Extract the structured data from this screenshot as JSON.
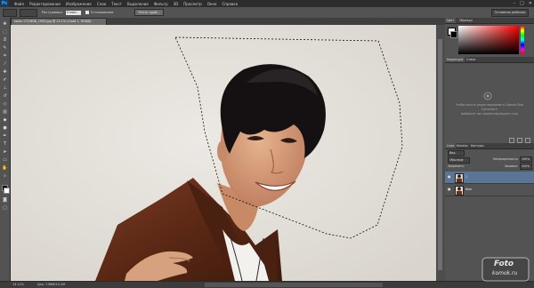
{
  "menubar": {
    "logo": "Ps",
    "items": [
      "Файл",
      "Редактирование",
      "Изображение",
      "Слои",
      "Текст",
      "Выделение",
      "Фильтр",
      "3D",
      "Просмотр",
      "Окно",
      "Справка"
    ]
  },
  "window_controls": [
    "–",
    "□",
    "✕"
  ],
  "options": {
    "feather_label": "Растушевка:",
    "feather_value": "0 пикс.",
    "antialias_label": "Сглаживание",
    "refine_button": "Уточн. край...",
    "workspace": "Основная рабочая среда"
  },
  "document": {
    "tab_title": "маке-1729838_1920.jpg @ 13.1% (Слой 1, RGB/8)"
  },
  "status": {
    "zoom": "13.11%",
    "doc_size": "Док: 7.88M/15.2M"
  },
  "panels": {
    "color_tabs": [
      "Цвет",
      "Образцы"
    ],
    "adjust_tabs": [
      "Коррекция",
      "Стили"
    ],
    "adjust_hint_1": "Чтобы начать редактирование в Camera Raw",
    "adjust_hint_2": "Щелкните",
    "adjust_hint_3": "выберите тип корректирующего слоя",
    "layer_tabs": [
      "Слои",
      "Каналы",
      "Контуры"
    ],
    "kind_filter": "Вид",
    "blend_mode": "Обычные",
    "opacity_label": "Непрозрачность:",
    "opacity_value": "100%",
    "lock_label": "Закрепить:",
    "fill_label": "Заливка:",
    "fill_value": "100%",
    "layers": [
      {
        "name": "1",
        "selected": true
      },
      {
        "name": "Фон",
        "selected": false
      }
    ]
  },
  "watermark": {
    "line1": "Foto",
    "line2": "komok.ru"
  },
  "colors": {
    "accent_selected_layer": "#5a7596",
    "canvas_background": "#e2dfd9"
  }
}
